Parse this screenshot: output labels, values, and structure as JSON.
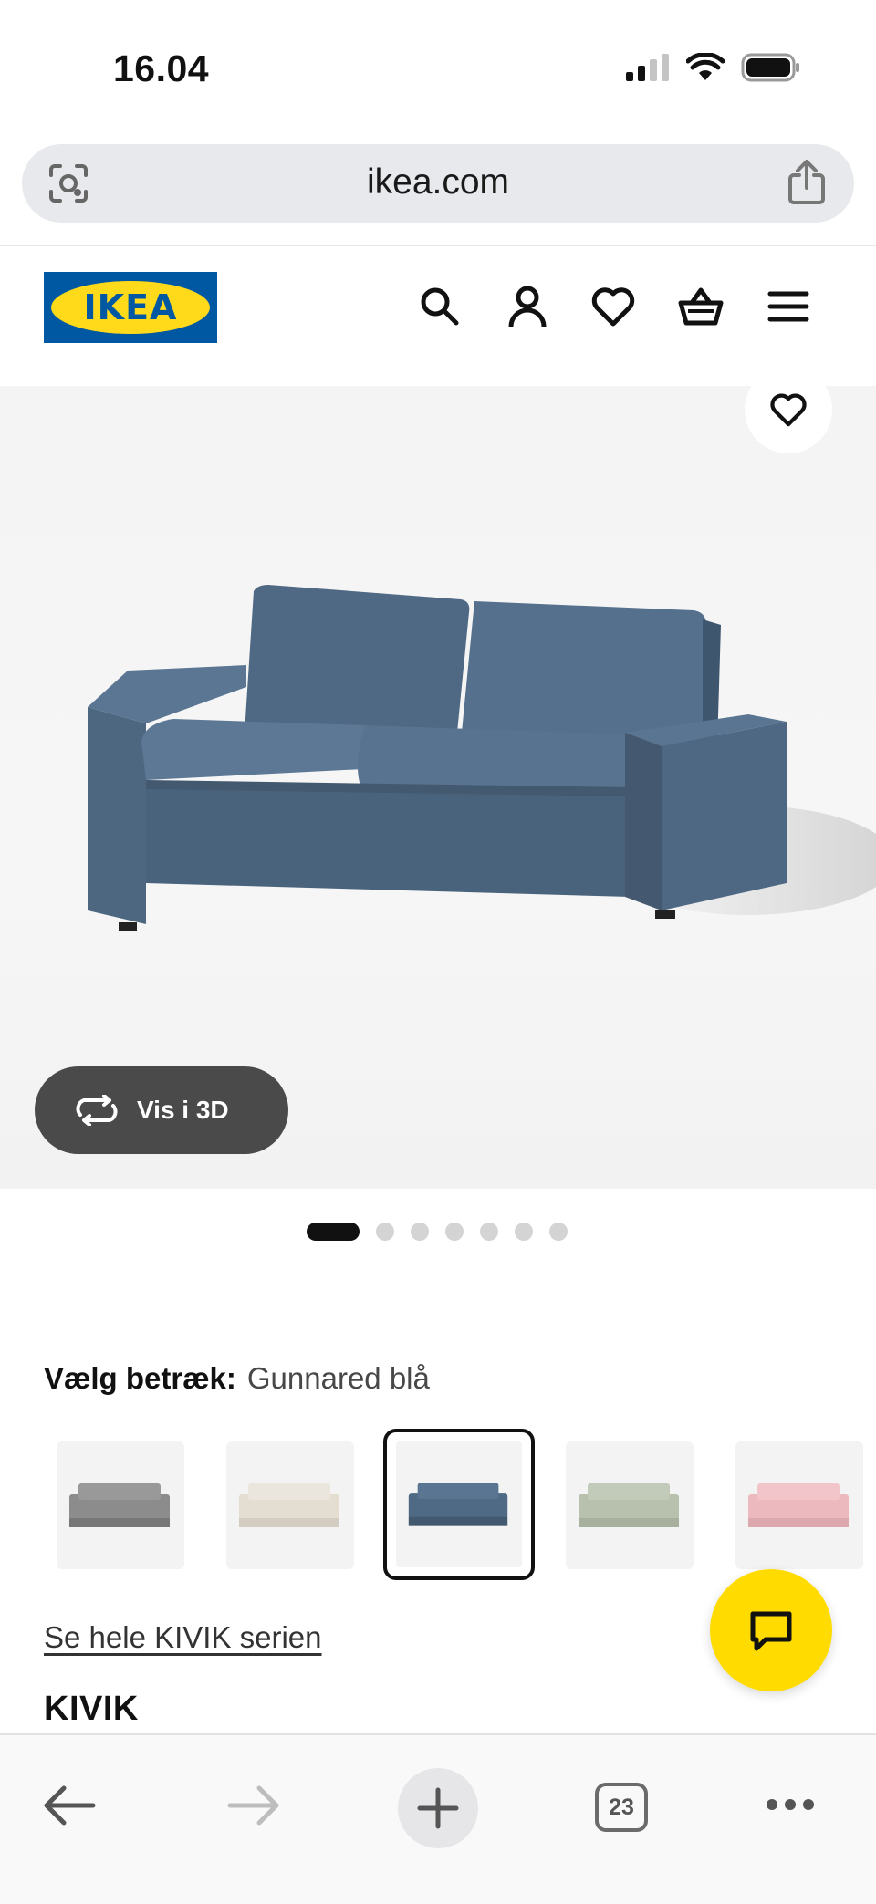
{
  "status_bar": {
    "time": "16.04"
  },
  "browser": {
    "url": "ikea.com",
    "open_tabs_count": "23"
  },
  "header": {
    "logo_text": "IKEA",
    "brand_colors": {
      "blue": "#0058a3",
      "yellow": "#ffda1a"
    },
    "icons": [
      "search-icon",
      "account-icon",
      "favorites-icon",
      "cart-icon",
      "menu-icon"
    ]
  },
  "product": {
    "view_3d_label": "Vis i 3D",
    "carousel": {
      "total": 7,
      "active": 1
    },
    "cover": {
      "label": "Vælg betræk:",
      "value": "Gunnared blå"
    },
    "swatches": [
      {
        "name": "grey",
        "color": "#8c8c8c",
        "selected": false
      },
      {
        "name": "beige",
        "color": "#e3ddd2",
        "selected": false
      },
      {
        "name": "gunnared-blue",
        "color": "#4f6a85",
        "selected": true
      },
      {
        "name": "green",
        "color": "#b7c1ae",
        "selected": false
      },
      {
        "name": "pink",
        "color": "#ecb9bf",
        "selected": false
      }
    ],
    "series_link": "Se hele KIVIK serien",
    "name": "KIVIK"
  }
}
